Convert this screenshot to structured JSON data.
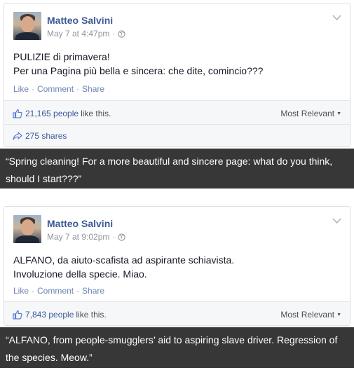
{
  "posts": [
    {
      "author": "Matteo Salvini",
      "timestamp": "May 7 at 4:47pm",
      "meta_separator": "·",
      "text_lines": [
        "PULIZIE di primavera!",
        "Per una Pagina più bella e sincera: che dite, comincio???"
      ],
      "actions": {
        "like": "Like",
        "comment": "Comment",
        "share": "Share",
        "separator": "·"
      },
      "likes_count": "21,165 people",
      "likes_suffix": "like this.",
      "sort_label": "Most Relevant",
      "shares_label": "275 shares",
      "caption": "“Spring cleaning! For a more beautiful and sincere page: what do you think, should I start???”"
    },
    {
      "author": "Matteo Salvini",
      "timestamp": "May 7 at 9:02pm",
      "meta_separator": "·",
      "text_lines": [
        "ALFANO, da aiuto-scafista ad aspirante schiavista.",
        "Involuzione della specie. Miao."
      ],
      "actions": {
        "like": "Like",
        "comment": "Comment",
        "share": "Share",
        "separator": "·"
      },
      "likes_count": "7,843 people",
      "likes_suffix": "like this.",
      "sort_label": "Most Relevant",
      "caption": "“ALFANO, from people-smugglers’ aid to aspiring slave driver. Regression of the species. Meow.”"
    }
  ],
  "colors": {
    "link_blue": "#3b5998",
    "action_blue": "#6d84b4",
    "caption_bg": "#373737",
    "meta_gray": "#90949c"
  },
  "icons": [
    "globe-icon",
    "chevron-down-icon",
    "thumbs-up-icon",
    "share-arrow-icon"
  ]
}
